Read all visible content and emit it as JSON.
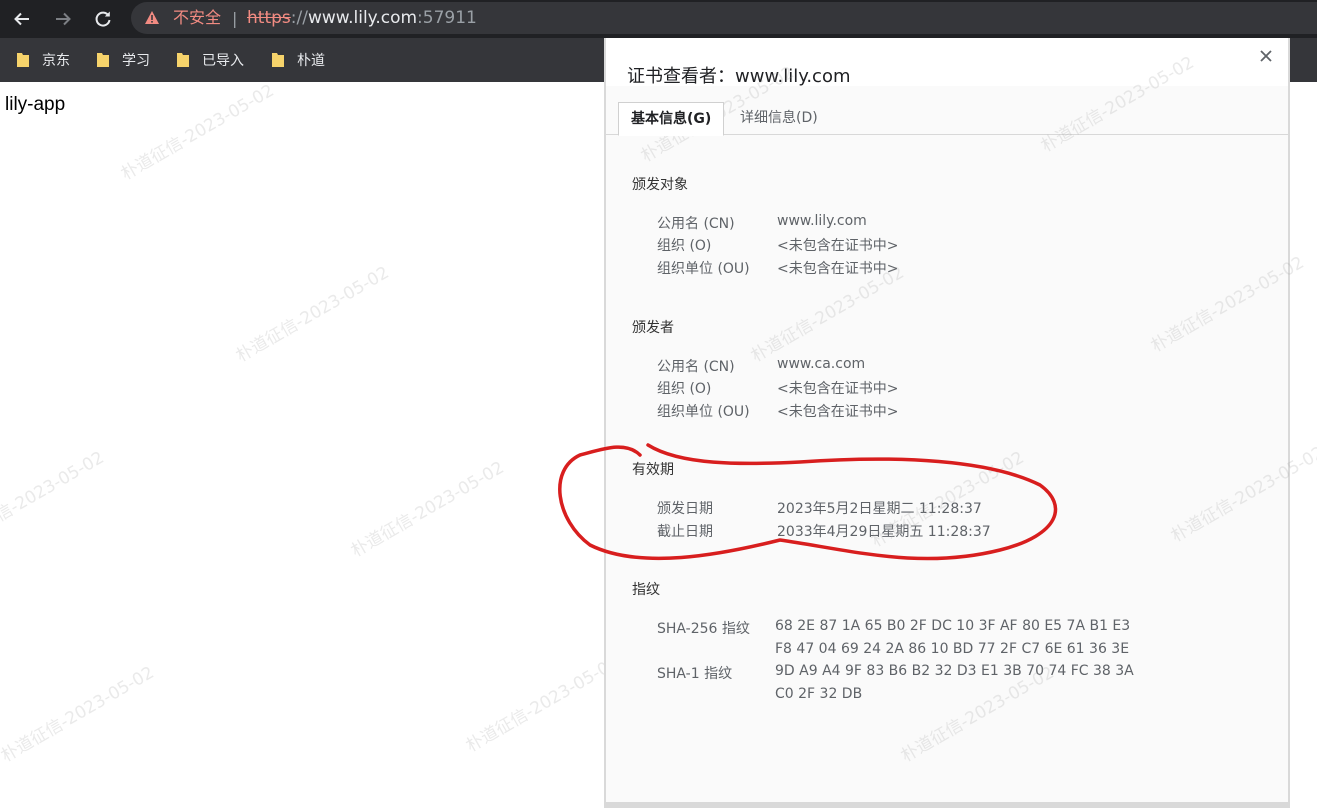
{
  "browser": {
    "security_label": "不安全",
    "url_scheme": "https",
    "url_separator": "://",
    "url_host": "www.lily.com",
    "url_port": ":57911",
    "icons": [
      "back-icon",
      "forward-icon",
      "reload-icon",
      "warning-icon"
    ]
  },
  "bookmarks": [
    {
      "label": "京东"
    },
    {
      "label": "学习"
    },
    {
      "label": "已导入"
    },
    {
      "label": "朴道"
    }
  ],
  "page": {
    "heading": "lily-app",
    "watermark": "朴道征信-2023-05-02"
  },
  "dialog": {
    "title": "证书查看者：www.lily.com",
    "tabs": [
      {
        "label": "基本信息(G)",
        "active": true
      },
      {
        "label": "详细信息(D)",
        "active": false
      }
    ],
    "subject": {
      "title": "颁发对象",
      "rows": [
        {
          "label": "公用名 (CN)",
          "value": "www.lily.com"
        },
        {
          "label": "组织 (O)",
          "value": "<未包含在证书中>"
        },
        {
          "label": "组织单位 (OU)",
          "value": "<未包含在证书中>"
        }
      ]
    },
    "issuer": {
      "title": "颁发者",
      "rows": [
        {
          "label": "公用名 (CN)",
          "value": "www.ca.com"
        },
        {
          "label": "组织 (O)",
          "value": "<未包含在证书中>"
        },
        {
          "label": "组织单位 (OU)",
          "value": "<未包含在证书中>"
        }
      ]
    },
    "validity": {
      "title": "有效期",
      "rows": [
        {
          "label": "颁发日期",
          "value": "2023年5月2日星期二 11:28:37"
        },
        {
          "label": "截止日期",
          "value": "2033年4月29日星期五 11:28:37"
        }
      ]
    },
    "fingerprints": {
      "title": "指纹",
      "sha256": {
        "label": "SHA-256 指纹",
        "line1": "68 2E 87 1A 65 B0 2F DC 10 3F AF 80 E5 7A B1 E3",
        "line2": "F8 47 04 69 24 2A 86 10 BD 77 2F C7 6E 61 36 3E"
      },
      "sha1": {
        "label": "SHA-1 指纹",
        "line1": "9D A9 A4 9F 83 B6 B2 32 D3 E1 3B 70 74 FC 38 3A",
        "line2": "C0 2F 32 DB"
      }
    }
  },
  "colors": {
    "toolbar": "#202124",
    "bookmarks_bar": "#35363a",
    "insecure": "#f28b82",
    "annotation": "#d81e1e"
  }
}
